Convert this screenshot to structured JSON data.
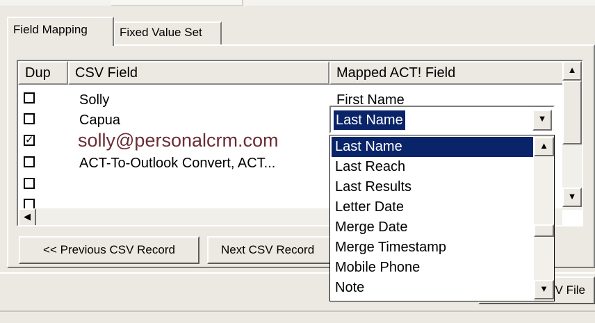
{
  "tabs": [
    {
      "label": "Field Mapping",
      "active": true
    },
    {
      "label": "Fixed Value Set",
      "active": false
    }
  ],
  "grid": {
    "columns": [
      "Dup",
      "CSV Field",
      "Mapped ACT! Field"
    ],
    "rows": [
      {
        "dup": false,
        "csv": "Solly",
        "mapped": "First Name"
      },
      {
        "dup": false,
        "csv": "Capua",
        "mapped": "Last Name"
      },
      {
        "dup": true,
        "csv": "solly@personalcrm.com",
        "mapped": ""
      },
      {
        "dup": false,
        "csv": "ACT-To-Outlook Convert, ACT...",
        "mapped": ""
      },
      {
        "dup": false,
        "csv": "",
        "mapped": ""
      },
      {
        "dup": false,
        "csv": "",
        "mapped": ""
      }
    ]
  },
  "combo": {
    "value": "Last Name",
    "options": [
      "Last Name",
      "Last Reach",
      "Last Results",
      "Letter Date",
      "Merge Date",
      "Merge Timestamp",
      "Mobile Phone",
      "Note"
    ],
    "selected_index": 0
  },
  "buttons": {
    "previous": "<< Previous CSV Record",
    "next": "Next CSV Record",
    "csv_file_partial": "V File"
  },
  "icons": {
    "up": "up-arrow-icon",
    "down": "down-arrow-icon",
    "left": "left-arrow-icon",
    "check": "checkmark-icon"
  },
  "colors": {
    "selection": "#0a246a",
    "face": "#ece9e2"
  }
}
